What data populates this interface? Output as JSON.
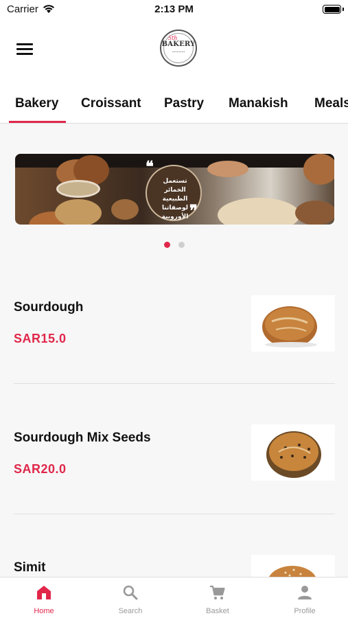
{
  "status_bar": {
    "carrier": "Carrier",
    "time": "2:13 PM"
  },
  "header": {
    "logo_text": "BAKERY",
    "logo_accent": "5th"
  },
  "category_tabs": [
    {
      "label": "Bakery",
      "selected": true
    },
    {
      "label": "Croissant",
      "selected": false
    },
    {
      "label": "Pastry",
      "selected": false
    },
    {
      "label": "Manakish",
      "selected": false
    },
    {
      "label": "Meals",
      "selected": false
    }
  ],
  "banner": {
    "text_lines": [
      "تستعمل",
      "الخمائر الطبيعية",
      "لوصفاتنا",
      "الأوروبية"
    ],
    "slide_count": 2,
    "active_slide": 1
  },
  "products": [
    {
      "name": "Sourdough",
      "price": "SAR15.0"
    },
    {
      "name": "Sourdough Mix Seeds",
      "price": "SAR20.0"
    },
    {
      "name": "Simit",
      "price": ""
    }
  ],
  "bottom_nav": [
    {
      "label": "Home",
      "icon": "home-icon",
      "active": true
    },
    {
      "label": "Search",
      "icon": "search-icon",
      "active": false
    },
    {
      "label": "Basket",
      "icon": "cart-icon",
      "active": false
    },
    {
      "label": "Profile",
      "icon": "person-icon",
      "active": false
    }
  ],
  "colors": {
    "accent": "#e0274a",
    "inactive": "#999999",
    "text": "#111111"
  }
}
